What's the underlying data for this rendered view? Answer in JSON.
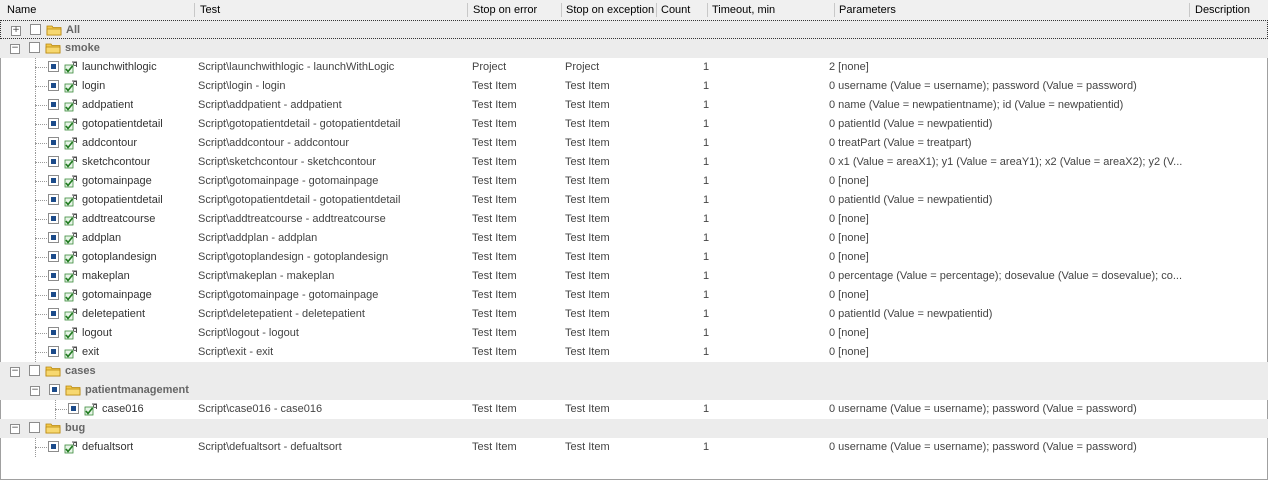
{
  "columns": {
    "name": "Name",
    "test": "Test",
    "stop_on_error": "Stop on error",
    "stop_on_exception": "Stop on exception",
    "count": "Count",
    "timeout": "Timeout, min",
    "parameters": "Parameters",
    "description": "Description"
  },
  "groups": {
    "all": "All",
    "smoke": "smoke",
    "cases": "cases",
    "patientmanagement": "patientmanagement",
    "bug": "bug"
  },
  "smoke_items": [
    {
      "name": "launchwithlogic",
      "test": "Script\\launchwithlogic - launchWithLogic",
      "err": "Project",
      "exc": "Project",
      "count": "1",
      "params": "2 [none]"
    },
    {
      "name": "login",
      "test": "Script\\login - login",
      "err": "Test Item",
      "exc": "Test Item",
      "count": "1",
      "params": "0 username (Value = username); password (Value = password)"
    },
    {
      "name": "addpatient",
      "test": "Script\\addpatient - addpatient",
      "err": "Test Item",
      "exc": "Test Item",
      "count": "1",
      "params": "0 name (Value = newpatientname); id (Value = newpatientid)"
    },
    {
      "name": "gotopatientdetail",
      "test": "Script\\gotopatientdetail - gotopatientdetail",
      "err": "Test Item",
      "exc": "Test Item",
      "count": "1",
      "params": "0 patientId (Value = newpatientid)"
    },
    {
      "name": "addcontour",
      "test": "Script\\addcontour - addcontour",
      "err": "Test Item",
      "exc": "Test Item",
      "count": "1",
      "params": "0 treatPart (Value = treatpart)"
    },
    {
      "name": "sketchcontour",
      "test": "Script\\sketchcontour - sketchcontour",
      "err": "Test Item",
      "exc": "Test Item",
      "count": "1",
      "params": "0 x1 (Value = areaX1); y1 (Value = areaY1); x2 (Value = areaX2); y2 (V..."
    },
    {
      "name": "gotomainpage",
      "test": "Script\\gotomainpage - gotomainpage",
      "err": "Test Item",
      "exc": "Test Item",
      "count": "1",
      "params": "0 [none]"
    },
    {
      "name": "gotopatientdetail",
      "test": "Script\\gotopatientdetail - gotopatientdetail",
      "err": "Test Item",
      "exc": "Test Item",
      "count": "1",
      "params": "0 patientId (Value = newpatientid)"
    },
    {
      "name": "addtreatcourse",
      "test": "Script\\addtreatcourse - addtreatcourse",
      "err": "Test Item",
      "exc": "Test Item",
      "count": "1",
      "params": "0 [none]"
    },
    {
      "name": "addplan",
      "test": "Script\\addplan - addplan",
      "err": "Test Item",
      "exc": "Test Item",
      "count": "1",
      "params": "0 [none]"
    },
    {
      "name": "gotoplandesign",
      "test": "Script\\gotoplandesign - gotoplandesign",
      "err": "Test Item",
      "exc": "Test Item",
      "count": "1",
      "params": "0 [none]"
    },
    {
      "name": "makeplan",
      "test": "Script\\makeplan - makeplan",
      "err": "Test Item",
      "exc": "Test Item",
      "count": "1",
      "params": "0 percentage (Value = percentage); dosevalue (Value = dosevalue); co..."
    },
    {
      "name": "gotomainpage",
      "test": "Script\\gotomainpage - gotomainpage",
      "err": "Test Item",
      "exc": "Test Item",
      "count": "1",
      "params": "0 [none]"
    },
    {
      "name": "deletepatient",
      "test": "Script\\deletepatient - deletepatient",
      "err": "Test Item",
      "exc": "Test Item",
      "count": "1",
      "params": "0 patientId (Value = newpatientid)"
    },
    {
      "name": "logout",
      "test": "Script\\logout - logout",
      "err": "Test Item",
      "exc": "Test Item",
      "count": "1",
      "params": "0 [none]"
    },
    {
      "name": "exit",
      "test": "Script\\exit - exit",
      "err": "Test Item",
      "exc": "Test Item",
      "count": "1",
      "params": "0 [none]"
    }
  ],
  "case_item": {
    "name": "case016",
    "test": "Script\\case016 - case016",
    "err": "Test Item",
    "exc": "Test Item",
    "count": "1",
    "params": "0 username (Value = username); password (Value = password)"
  },
  "bug_item": {
    "name": "defualtsort",
    "test": "Script\\defualtsort - defualtsort",
    "err": "Test Item",
    "exc": "Test Item",
    "count": "1",
    "params": "0 username (Value = username); password (Value = password)"
  },
  "icons": {
    "expand": "plus-box-icon",
    "collapse": "minus-box-icon",
    "folder": "folder-icon",
    "test": "test-item-icon"
  },
  "colors": {
    "header_bg": "#f0f0f0",
    "group_bg": "#ececec",
    "checkbox_fill": "#1c4b8a",
    "folder_yellow": "#f2c94c"
  }
}
